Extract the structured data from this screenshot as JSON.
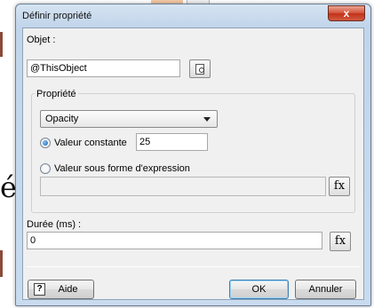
{
  "window": {
    "title": "Définir propriété",
    "close_glyph": "x"
  },
  "objet": {
    "label": "Objet :",
    "value": "@ThisObject",
    "browse_icon": "browse-icon"
  },
  "propriete": {
    "group_label": "Propriété",
    "selected_property": "Opacity",
    "radio_constant": {
      "label": "Valeur constante",
      "checked": true,
      "value": "25"
    },
    "radio_expression": {
      "label": "Valeur sous forme d'expression",
      "checked": false,
      "value": ""
    },
    "fx_label": "fx"
  },
  "duree": {
    "label": "Durée (ms) :",
    "value": "0",
    "fx_label": "fx"
  },
  "buttons": {
    "help": "Aide",
    "help_icon_glyph": "?",
    "ok": "OK",
    "cancel": "Annuler"
  },
  "background": {
    "glyph": "é"
  }
}
